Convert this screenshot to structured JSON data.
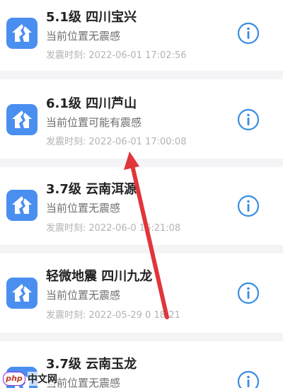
{
  "list": {
    "time_label": "发震时刻:",
    "items": [
      {
        "title": "5.1级 四川宝兴",
        "feel": "当前位置无震感",
        "time": "2022-06-01 17:02:56"
      },
      {
        "title": "6.1级 四川芦山",
        "feel": "当前位置可能有震感",
        "time": "2022-06-01 17:00:08"
      },
      {
        "title": "3.7级 云南洱源",
        "feel": "当前位置无震感",
        "time": "2022-06-0 16:21:08"
      },
      {
        "title": "轻微地震 四川九龙",
        "feel": "当前位置无震感",
        "time": "2022-05-29 0 18:21"
      },
      {
        "title": "3.7级 云南玉龙",
        "feel": "当前位置无震感",
        "time": ""
      }
    ]
  },
  "icons": {
    "quake": "house-crack-icon",
    "info": "info-circle-icon"
  },
  "colors": {
    "icon_bg": "#4a8ff0",
    "info": "#3a8de0",
    "arrow": "#e0353a"
  },
  "watermark": {
    "logo": "php",
    "text": "中文网"
  }
}
